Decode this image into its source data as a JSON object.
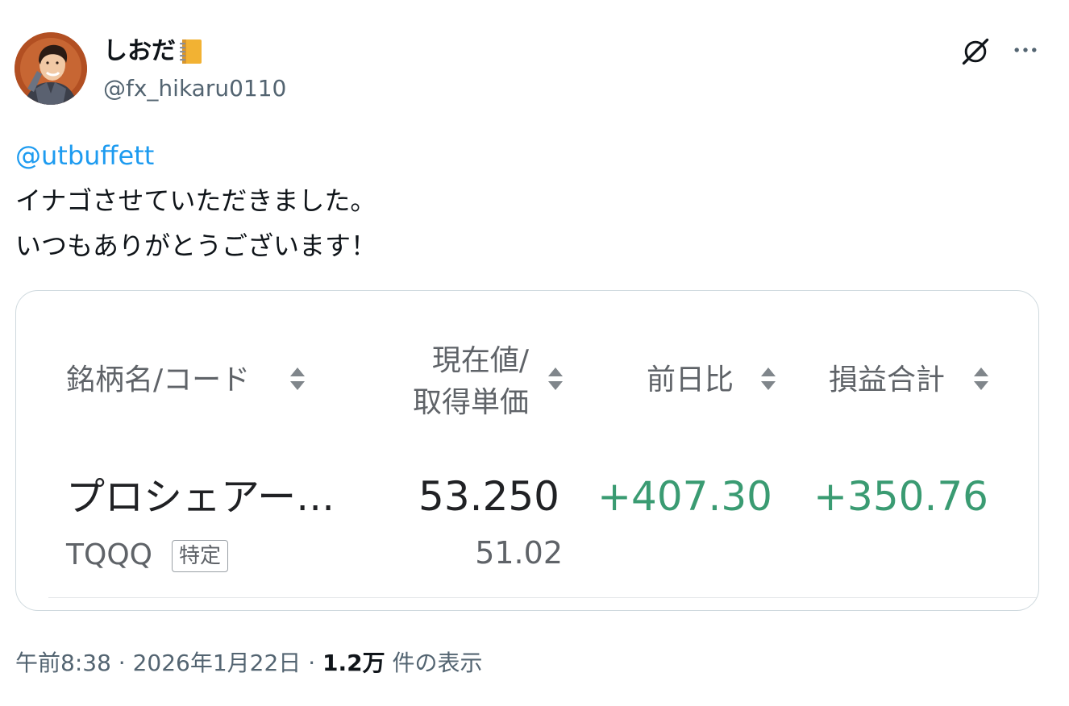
{
  "author": {
    "display_name": "しおだ",
    "handle": "@fx_hikaru0110",
    "avatar_icon": "avatar",
    "name_emoji_icon": "notebook-icon"
  },
  "header_actions": {
    "grok_icon": "grok-icon",
    "more_icon": "more-icon"
  },
  "tweet": {
    "mention": "@utbuffett",
    "line1": "イナゴさせていただきました。",
    "line2": "いつもありがとうございます！"
  },
  "card": {
    "columns": {
      "name_code": "銘柄名/コード",
      "price_line1": "現在値/",
      "price_line2": "取得単価",
      "day_change": "前日比",
      "total_pl": "損益合計"
    },
    "row": {
      "name": "プロシェアー…",
      "code": "TQQQ",
      "badge": "特定",
      "current_price": "53.250",
      "acquisition_price": "51.02",
      "day_change": "+407.30",
      "total_pl": "+350.76"
    },
    "colors": {
      "positive": "#3a9b72",
      "header_text": "#5f6368"
    }
  },
  "meta": {
    "time": "午前8:38",
    "sep1": " · ",
    "date": "2026年1月22日",
    "sep2": " · ",
    "views_count": "1.2万",
    "views_label": " 件の表示"
  },
  "colors": {
    "link": "#1d9bf0",
    "secondary_text": "#536471"
  }
}
